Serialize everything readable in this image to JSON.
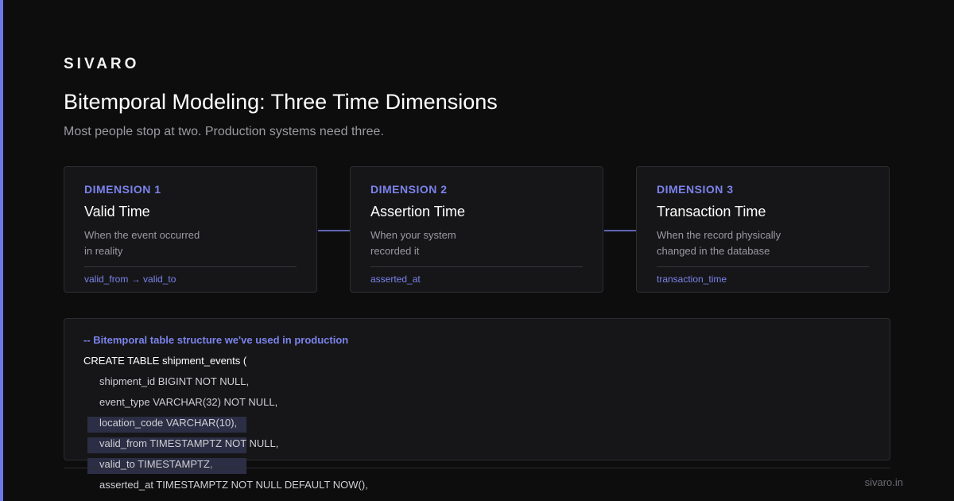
{
  "brand": "SIVARO",
  "title": "Bitemporal Modeling: Three Time Dimensions",
  "subtitle": "Most people stop at two. Production systems need three.",
  "cards": [
    {
      "kicker": "DIMENSION 1",
      "name": "Valid Time",
      "desc_line1": "When the event occurred",
      "desc_line2": "in reality",
      "field": "valid_from → valid_to"
    },
    {
      "kicker": "DIMENSION 2",
      "name": "Assertion Time",
      "desc_line1": "When your system",
      "desc_line2": "recorded it",
      "field": "asserted_at"
    },
    {
      "kicker": "DIMENSION 3",
      "name": "Transaction Time",
      "desc_line1": "When the record physically",
      "desc_line2": "changed in the database",
      "field": "transaction_time"
    }
  ],
  "code": {
    "comment": "-- Bitemporal table structure we've used in production",
    "lines": [
      "CREATE TABLE shipment_events (",
      "shipment_id BIGINT NOT NULL,",
      "event_type VARCHAR(32) NOT NULL,",
      "location_code VARCHAR(10),",
      "valid_from TIMESTAMPTZ NOT NULL,",
      "valid_to TIMESTAMPTZ,",
      "asserted_at TIMESTAMPTZ NOT NULL DEFAULT NOW(),"
    ]
  },
  "footer": {
    "url": "sivaro.in"
  },
  "colors": {
    "accent": "#7b83ec",
    "background": "#0d0d0e",
    "card": "#161618"
  }
}
